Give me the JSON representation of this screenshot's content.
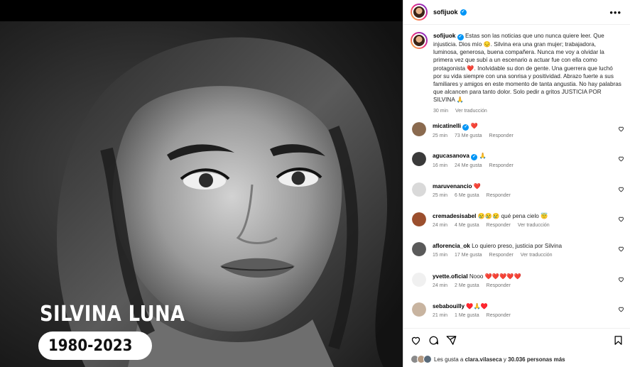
{
  "post": {
    "image": {
      "name_text": "SILVINA LUNA",
      "years_text": "1980-2023"
    },
    "header": {
      "username": "sofijuok",
      "verified": true,
      "more_icon": "more-horizontal-icon"
    },
    "caption": {
      "username": "sofijuok",
      "text": "Estas son las noticias que uno nunca quiere leer. Que injusticia. Dios mío 😔. Silvina era una gran mujer; trabajadora, luminosa, generosa, buena compañera. Nunca me voy a olvidar la primera vez que subí a un escenario a actuar fue con ella como protagonista ❤️. Inolvidable su don de gente. Una guerrera que luchó por su vida siempre con una sonrisa y positividad. Abrazo fuerte a sus familiares y amigos en este momento de tanta angustia. No hay palabras que alcancen para tanto dolor. Solo pedir a gritos JUSTICIA POR SILVINA 🙏",
      "time": "30 min",
      "translate": "Ver traducción"
    },
    "comments": [
      {
        "username": "micatinelli",
        "verified": true,
        "text": "❤️",
        "time": "25 min",
        "likes": "73 Me gusta",
        "reply": "Responder",
        "translate": "",
        "avatar_color": "#8a6a4f"
      },
      {
        "username": "agucasanova",
        "verified": true,
        "text": "🙏",
        "time": "16 min",
        "likes": "24 Me gusta",
        "reply": "Responder",
        "translate": "",
        "avatar_color": "#3a3a3a"
      },
      {
        "username": "maruvenancio",
        "verified": false,
        "text": "❤️",
        "time": "25 min",
        "likes": "6 Me gusta",
        "reply": "Responder",
        "translate": "",
        "avatar_color": "#d9d9d9"
      },
      {
        "username": "cremadesisabel",
        "verified": false,
        "text": "😢😢😢 qué pena cielo 😇",
        "time": "24 min",
        "likes": "4 Me gusta",
        "reply": "Responder",
        "translate": "Ver traducción",
        "avatar_color": "#9b4f2e"
      },
      {
        "username": "aflorencia_ok",
        "verified": false,
        "text": "Lo quiero preso, justicia por Silvina",
        "time": "15 min",
        "likes": "17 Me gusta",
        "reply": "Responder",
        "translate": "Ver traducción",
        "avatar_color": "#5a5a5a"
      },
      {
        "username": "yvette.oficial",
        "verified": false,
        "text": "Nooo ❤️❤️❤️❤️❤️",
        "time": "24 min",
        "likes": "2 Me gusta",
        "reply": "Responder",
        "translate": "",
        "avatar_color": "#f0f0f0"
      },
      {
        "username": "sebabouilly",
        "verified": false,
        "text": "♥️🙏♥️",
        "time": "21 min",
        "likes": "1 Me gusta",
        "reply": "Responder",
        "translate": "",
        "avatar_color": "#c8b4a0"
      }
    ],
    "actions": {
      "like_icon": "heart-icon",
      "comment_icon": "comment-icon",
      "share_icon": "share-icon",
      "save_icon": "bookmark-icon"
    },
    "likes": {
      "prefix": "Les gusta a",
      "user": "clara.vilaseca",
      "middle": "y",
      "count": "30.036 personas más"
    }
  },
  "colors": {
    "accent": "#0095f6",
    "heart": "#ff3040",
    "muted": "#737373"
  }
}
